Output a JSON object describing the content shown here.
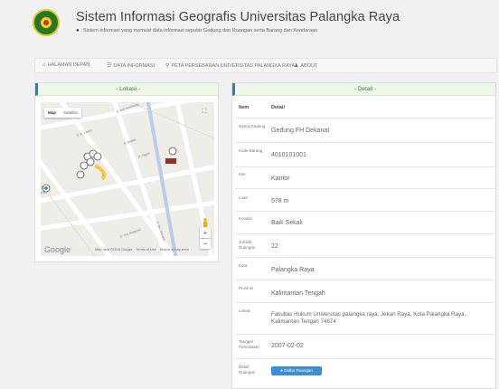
{
  "header": {
    "title": "Sistem Informasi Geografis Universitas Palangka Raya",
    "subtitle": "Sistem informasi yang memuat data informasi seputar Gedung dan Ruangan serta Barang dan Kendaraan"
  },
  "nav": {
    "items": [
      {
        "label": "HALAMAN DEPAN",
        "icon": "home-icon"
      },
      {
        "label": "DATA INFORMASI",
        "icon": "list-icon"
      },
      {
        "label": "PETA PERSEBARAN UNIVERSITAS PALANGKA RAYA",
        "icon": "map-marker-icon"
      },
      {
        "label": "ABOUT",
        "icon": "user-icon"
      }
    ]
  },
  "lokasi": {
    "heading": "- Lokasi -",
    "map_type": {
      "map": "Map",
      "satellite": "Satellite"
    },
    "footer": {
      "data": "Map data ©2018 Google",
      "terms": "Terms of Use",
      "report": "Report a map error"
    },
    "google": "Google"
  },
  "detail": {
    "heading": "- Detail -",
    "col_item": "Item",
    "col_detail": "Detail",
    "rows": [
      {
        "key": "Nama Gedung",
        "value": "Gedung FH Dekanat"
      },
      {
        "key": "Kode Barang",
        "value": "4010101001"
      },
      {
        "key": "Kas",
        "value": "Kantor"
      },
      {
        "key": "Luas",
        "value": "578 m"
      },
      {
        "key": "Kondisi",
        "value": "Baik Sekali"
      },
      {
        "key": "Jumlah Ruangan",
        "value": "22"
      },
      {
        "key": "Kota",
        "value": "Palangka Raya"
      },
      {
        "key": "Provinsi",
        "value": "Kalimantan Tengah"
      },
      {
        "key": "Lokasi",
        "value": "Fakultas Hukum Universitas palangka raya, Jekan Raya, Kota Palangka Raya, Kalimantan Tengah 74874"
      },
      {
        "key": "Tanggal Pencatatan",
        "value": "2007-02-02"
      }
    ],
    "detail_ruangan_key": "Detail Ruangan",
    "daftar_ruangan_label": "Daftar Ruangan"
  }
}
